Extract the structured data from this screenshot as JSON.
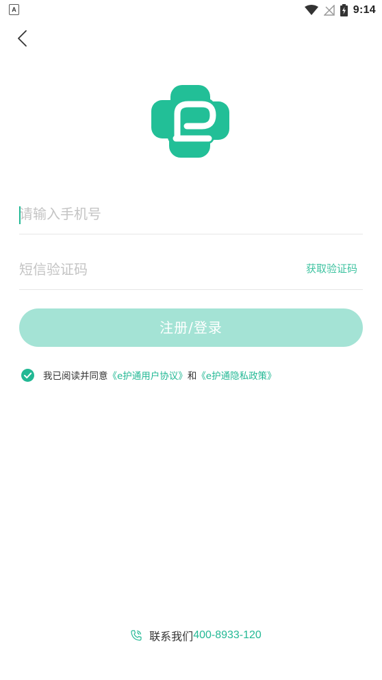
{
  "status_bar": {
    "app_icon_letter": "A",
    "time": "9:14"
  },
  "logo": {
    "name": "e护通"
  },
  "form": {
    "phone_placeholder": "请输入手机号",
    "code_placeholder": "短信验证码",
    "get_code_label": "获取验证码",
    "submit_label": "注册/登录"
  },
  "agreement": {
    "checked": true,
    "prefix": "我已阅读并同意",
    "user_agreement": "《e护通用户协议》",
    "and": "和",
    "privacy_policy": "《e护通隐私政策》"
  },
  "contact": {
    "label": "联系我们",
    "phone": "400-8933-120"
  },
  "colors": {
    "accent": "#22b894",
    "button_disabled": "#a4e3d5",
    "link": "#22b894"
  }
}
